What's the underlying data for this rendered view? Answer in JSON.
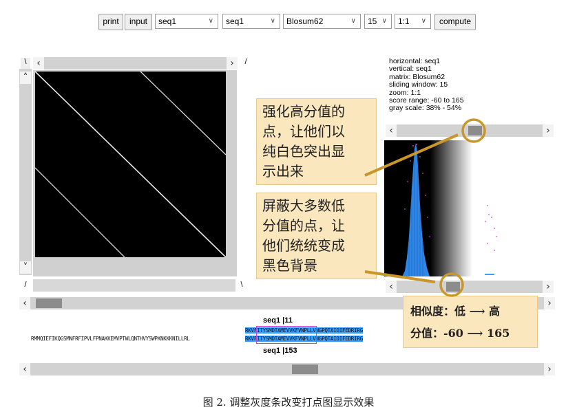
{
  "toolbar": {
    "print_label": "print",
    "input_label": "input",
    "horizontal_select": "seq1",
    "vertical_select": "seq1",
    "matrix_select": "Blosum62",
    "window_select": "15",
    "zoom_select": "1:1",
    "compute_label": "compute"
  },
  "corner_labels": {
    "top_left": "\\",
    "top_right": "/",
    "bottom_left": "/",
    "bottom_right": "\\"
  },
  "info": {
    "horizontal": "horizontal: seq1",
    "vertical": "vertical: seq1",
    "matrix": "matrix: Blosum62",
    "window": "sliding window: 15",
    "zoom": "zoom: 1:1",
    "score_range": "score range: -60 to 165",
    "gray_scale": "gray scale: 38% - 54%"
  },
  "callout_top": {
    "lines": [
      "强化高分值的",
      "点，让他们以",
      "纯白色突出显",
      "示出来"
    ]
  },
  "callout_mid": {
    "lines": [
      "屏蔽大多数低",
      "分值的点，让",
      "他们统统变成",
      "黑色背景"
    ]
  },
  "callout_bottom": {
    "line1": "相似度：低 ⟶ 高",
    "line2": "分值：-60 ⟶ 165"
  },
  "alignment": {
    "top_label": "seq1",
    "top_pos": "11",
    "bottom_label": "seq1",
    "bottom_pos": "153",
    "top_seq": "RKVFITYSMDTAMEVVKFVNPLLVNGPQTAIDIFEDRIRG",
    "bottom_prefix": "RMMQIEFIKQGSMNFRFIPVLFPNAKKEMVPTWLQNTHVYSWPKNKKKNILLRL",
    "bottom_seq": "RKVFITYSMDTAMEVVKFVNPLLVNGPQTAIDIFEDRIRG"
  },
  "caption": "图 2. 调整灰度条改变打点图显示效果",
  "colors": {
    "callout_bg": "#fbe7bd",
    "arrow": "#c8962a",
    "histogram": "#2e86e6",
    "highlight": "#3aa0ff"
  }
}
